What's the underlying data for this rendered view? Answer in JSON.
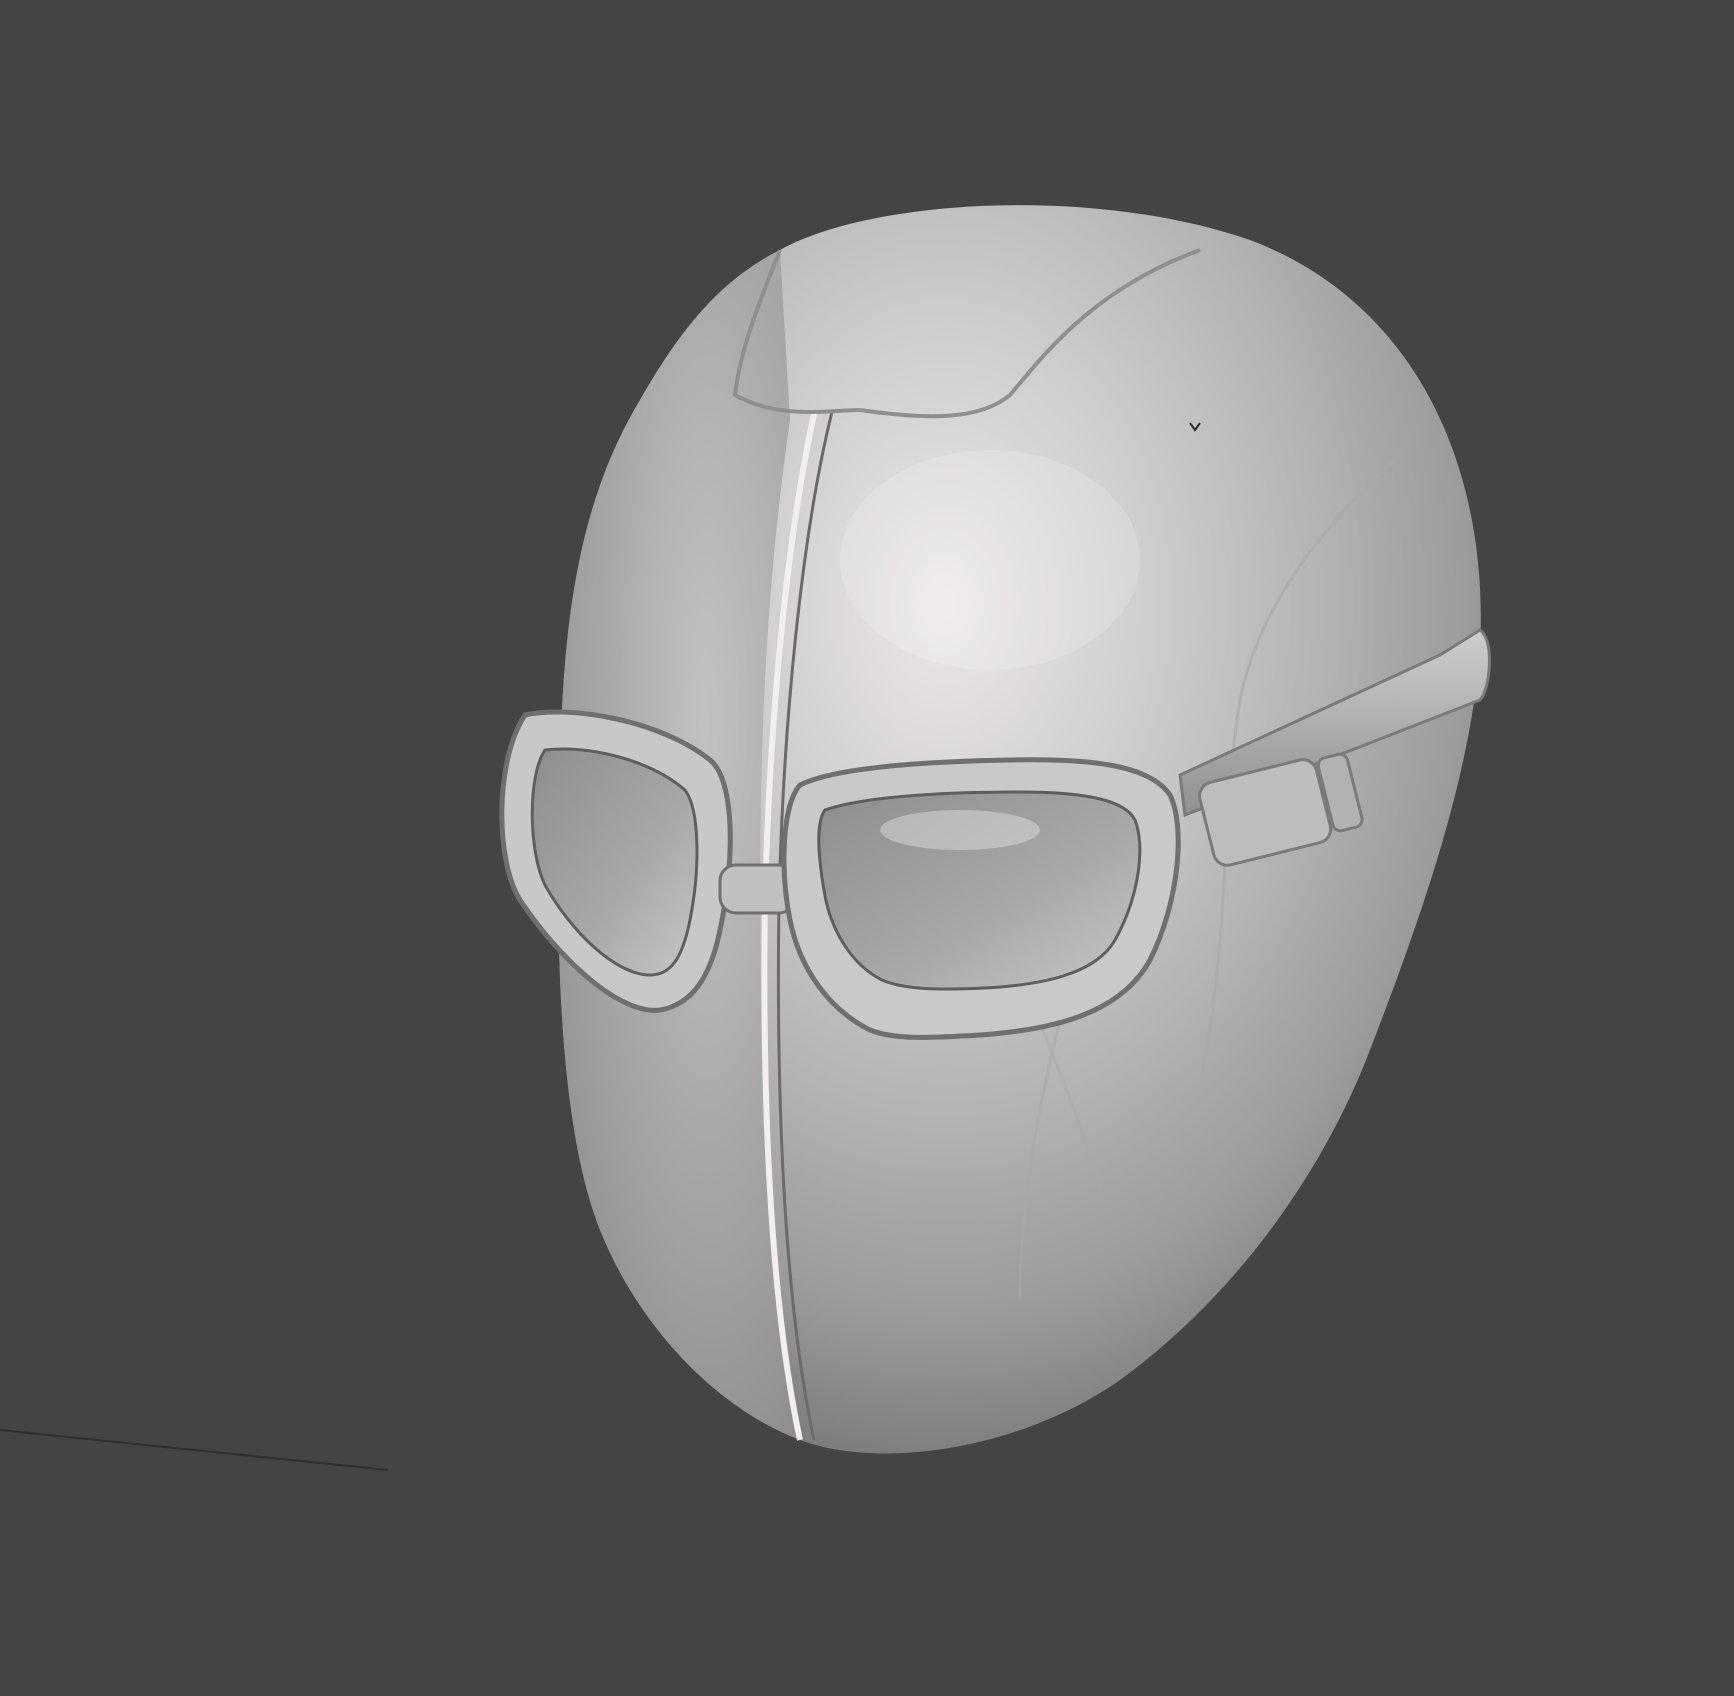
{
  "viewport": {
    "background_color": "#444345",
    "model": {
      "type": "3d-sculpt",
      "subject": "padded-mask-with-goggles",
      "material_color": "#b9b8ba",
      "highlight_color": "#ebe6ea",
      "shadow_color": "#6f6e70"
    },
    "ground_line_color": "#2f2e30"
  }
}
